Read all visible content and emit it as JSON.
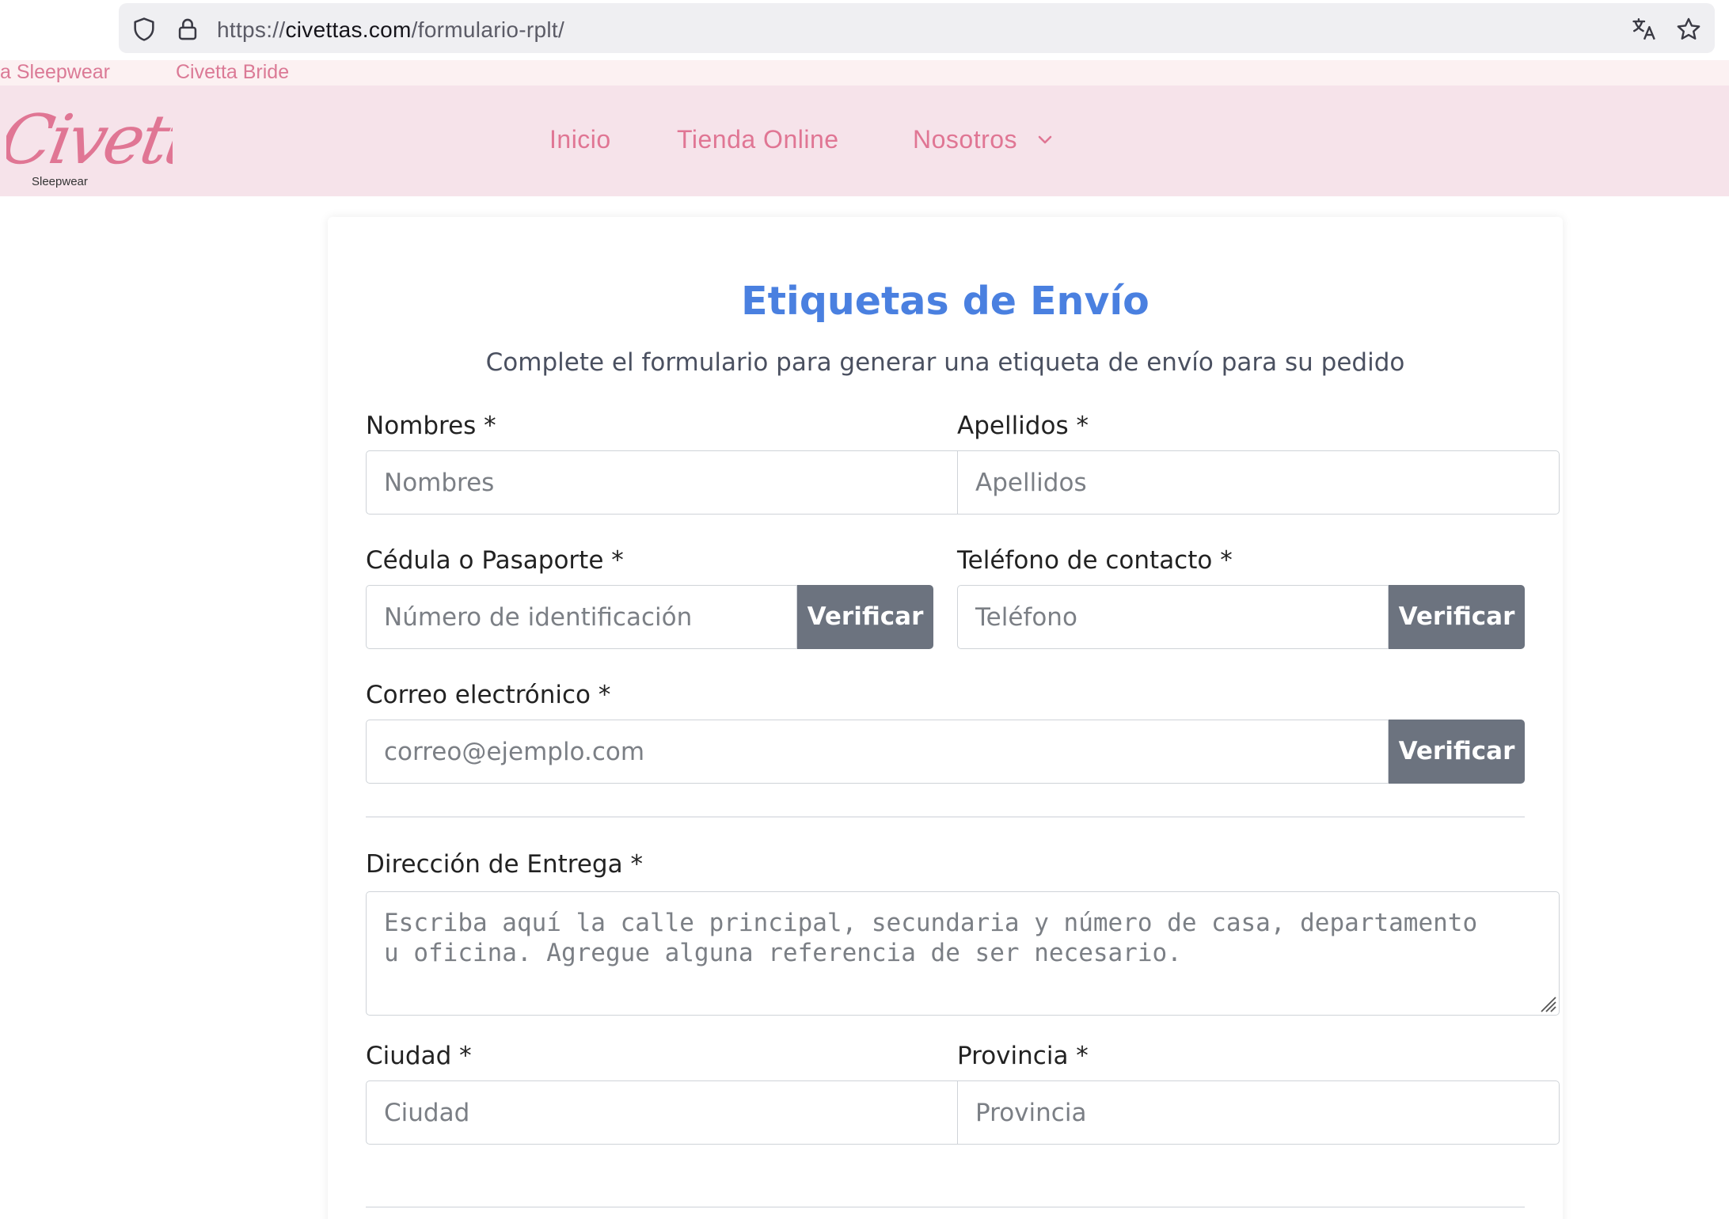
{
  "browser": {
    "url_scheme": "https://",
    "url_host": "civettas.com",
    "url_path": "/formulario-rplt/"
  },
  "topbar": {
    "links": [
      "a Sleepwear",
      "Civetta Bride"
    ]
  },
  "header": {
    "logo_text": "Civetta",
    "logo_subtext": "Sleepwear",
    "nav": [
      "Inicio",
      "Tienda Online",
      "Nosotros"
    ]
  },
  "form": {
    "title": "Etiquetas de Envío",
    "subtitle": "Complete el formulario para generar una etiqueta de envío para su pedido",
    "nombres": {
      "label": "Nombres *",
      "placeholder": "Nombres"
    },
    "apellidos": {
      "label": "Apellidos *",
      "placeholder": "Apellidos"
    },
    "cedula": {
      "label": "Cédula o Pasaporte *",
      "placeholder": "Número de identificación",
      "button": "Verificar"
    },
    "telefono": {
      "label": "Teléfono de contacto *",
      "placeholder": "Teléfono",
      "button": "Verificar"
    },
    "correo": {
      "label": "Correo electrónico *",
      "placeholder": "correo@ejemplo.com",
      "button": "Verificar"
    },
    "direccion": {
      "label": "Dirección de Entrega *",
      "placeholder_line1": "Escriba aquí la calle principal, secundaria y número de casa, departamento",
      "placeholder_line2": "u oficina. Agregue alguna referencia de ser necesario."
    },
    "ciudad": {
      "label": "Ciudad *",
      "placeholder": "Ciudad"
    },
    "provincia": {
      "label": "Provincia *",
      "placeholder": "Provincia"
    }
  },
  "colors": {
    "brand_pink": "#e07694",
    "title_blue": "#4a80e0",
    "button_gray": "#6c737f",
    "header_bg": "#f6e3ea"
  }
}
